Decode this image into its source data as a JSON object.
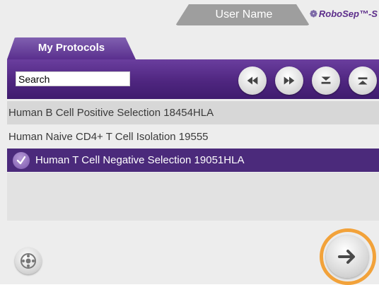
{
  "header": {
    "user_name": "User Name",
    "logo_text": "RoboSep™-S"
  },
  "tabs": [
    {
      "label": "My Protocols"
    }
  ],
  "toolbar": {
    "search_value": "Search",
    "buttons": [
      {
        "icon": "rewind-icon"
      },
      {
        "icon": "fast-forward-icon"
      },
      {
        "icon": "chevron-down-icon"
      },
      {
        "icon": "chevron-up-icon"
      }
    ]
  },
  "protocols": [
    {
      "label": "Human B Cell Positive Selection 18454HLA",
      "selected": false
    },
    {
      "label": "Human Naive CD4+ T Cell Isolation 19555",
      "selected": false
    },
    {
      "label": "Human T Cell Negative Selection 19051HLA",
      "selected": true
    }
  ],
  "footer": {
    "settings_icon": "settings-icon",
    "next_icon": "arrow-right-icon"
  },
  "colors": {
    "accent_purple": "#4b2a7b",
    "highlight_orange": "#f2a23a"
  }
}
